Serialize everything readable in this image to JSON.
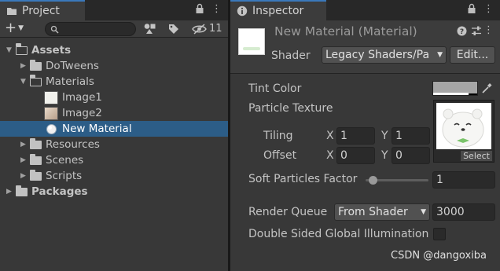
{
  "project": {
    "tab_label": "Project",
    "hidden_count": "11",
    "search": {
      "value": "",
      "placeholder": ""
    },
    "tree": [
      {
        "label": "Assets",
        "bold": true,
        "expanded": true
      },
      {
        "label": "DoTweens"
      },
      {
        "label": "Materials",
        "expanded": true
      },
      {
        "label": "Image1"
      },
      {
        "label": "Image2"
      },
      {
        "label": "New Material",
        "selected": true
      },
      {
        "label": "Resources"
      },
      {
        "label": "Scenes"
      },
      {
        "label": "Scripts"
      },
      {
        "label": "Packages",
        "bold": true
      }
    ]
  },
  "inspector": {
    "tab_label": "Inspector",
    "title": "New Material (Material)",
    "shader_label": "Shader",
    "shader_value": "Legacy Shaders/Pa",
    "edit_label": "Edit...",
    "tint_color_label": "Tint Color",
    "tint_color": "#a6a6a6",
    "particle_texture_label": "Particle Texture",
    "tiling_label": "Tiling",
    "offset_label": "Offset",
    "x_label": "X",
    "y_label": "Y",
    "tiling_x": "1",
    "tiling_y": "1",
    "offset_x": "0",
    "offset_y": "0",
    "select_label": "Select",
    "soft_particles_label": "Soft Particles Factor",
    "soft_particles_value": "1",
    "soft_particles_fraction": 0.12,
    "render_queue_label": "Render Queue",
    "render_queue_mode": "From Shader",
    "render_queue_value": "3000",
    "double_sided_label": "Double Sided Global Illumination",
    "double_sided_checked": false
  },
  "watermark": "CSDN @dangoxiba",
  "colors": {
    "selection": "#2c5d87",
    "tab_accent": "#3a79bb",
    "panel_bg": "#383838"
  }
}
